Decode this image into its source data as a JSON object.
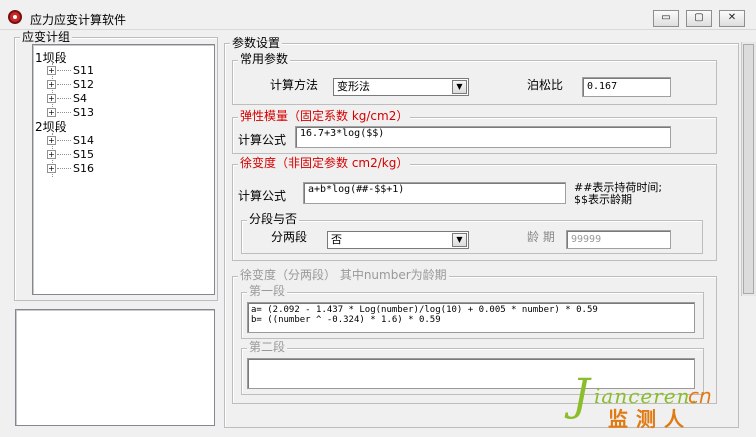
{
  "window": {
    "title": "应力应变计算软件",
    "minimize_glyph": "▭",
    "maximize_glyph": "▢",
    "close_glyph": "✕"
  },
  "left_panel": {
    "group_title": "应变计组",
    "tree": [
      {
        "label": "1坝段",
        "children": [
          "S11",
          "S12",
          "S4",
          "S13"
        ]
      },
      {
        "label": "2坝段",
        "children": [
          "S14",
          "S15",
          "S16"
        ]
      }
    ],
    "expander_glyph": "+"
  },
  "params": {
    "group_title": "参数设置",
    "common": {
      "title": "常用参数",
      "method_label": "计算方法",
      "method_value": "变形法",
      "poisson_label": "泊松比",
      "poisson_value": "0.167"
    },
    "elastic": {
      "title": "弹性模量（固定系数 kg/cm2）",
      "formula_label": "计算公式",
      "formula_value": "16.7+3*log($$)"
    },
    "creep": {
      "title": "徐变度（非固定参数 cm2/kg）",
      "formula_label": "计算公式",
      "formula_value": "a+b*log(##-$$+1)",
      "note_line1": "##表示持荷时间;",
      "note_line2": "$$表示龄期",
      "segment": {
        "title": "分段与否",
        "label": "分两段",
        "value": "否",
        "age_label": "龄 期",
        "age_value": "99999"
      }
    },
    "creep_two": {
      "title": "徐变度（分两段）  其中number为龄期",
      "seg1_title": "第一段",
      "seg1_text": "a= (2.092 - 1.437 * Log(number)/log(10) + 0.005 * number) * 0.59\nb= ((number ^ -0.324) * 1.6) * 0.59",
      "seg2_title": "第二段",
      "seg2_text": ""
    }
  },
  "watermark": {
    "j": "J",
    "rest": "ianceren.",
    "cn": "cn",
    "zh": "监测人"
  },
  "arrow_glyph": "▼"
}
